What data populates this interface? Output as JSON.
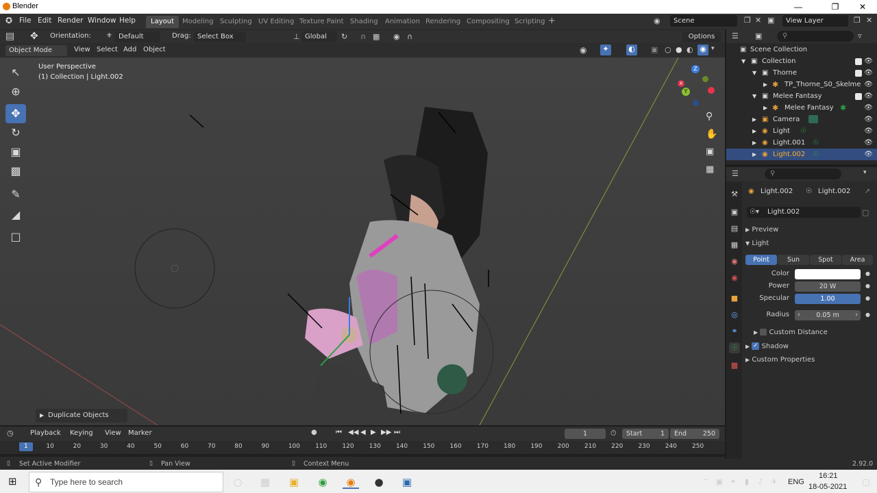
{
  "window": {
    "title": "Blender"
  },
  "menus": [
    "File",
    "Edit",
    "Render",
    "Window",
    "Help"
  ],
  "workspaces": [
    "Layout",
    "Modeling",
    "Sculpting",
    "UV Editing",
    "Texture Paint",
    "Shading",
    "Animation",
    "Rendering",
    "Compositing",
    "Scripting"
  ],
  "active_workspace": "Layout",
  "scene": "Scene",
  "view_layer": "View Layer",
  "header": {
    "orientation_label": "Orientation:",
    "orientation_value": "Default",
    "drag_label": "Drag:",
    "drag_value": "Select Box",
    "transform_orientation": "Global",
    "options": "Options"
  },
  "viewport": {
    "mode": "Object Mode",
    "menu": [
      "View",
      "Select",
      "Add",
      "Object"
    ],
    "overlay_title": "User Perspective",
    "overlay_sub": "(1) Collection | Light.002",
    "operator_panel": "Duplicate Objects",
    "gizmo_axes": [
      "Z",
      "X",
      "Y"
    ]
  },
  "outliner": {
    "items": [
      {
        "label": "Scene Collection",
        "level": 0
      },
      {
        "label": "Collection",
        "level": 1
      },
      {
        "label": "Thorne",
        "level": 2
      },
      {
        "label": "TP_Thorne_S0_Skelme",
        "level": 3
      },
      {
        "label": "Melee Fantasy",
        "level": 2
      },
      {
        "label": "Melee Fantasy",
        "level": 3
      },
      {
        "label": "Camera",
        "level": 2
      },
      {
        "label": "Light",
        "level": 2
      },
      {
        "label": "Light.001",
        "level": 2
      },
      {
        "label": "Light.002",
        "level": 2
      }
    ],
    "selected": "Light.002"
  },
  "properties": {
    "object_name": "Light.002",
    "data_name": "Light.002",
    "datablock": "Light.002",
    "sections": {
      "preview": "Preview",
      "light": "Light",
      "custom_distance": "Custom Distance",
      "shadow": "Shadow",
      "custom_properties": "Custom Properties"
    },
    "light_types": [
      "Point",
      "Sun",
      "Spot",
      "Area"
    ],
    "active_type": "Point",
    "color_label": "Color",
    "power_label": "Power",
    "power_value": "20 W",
    "specular_label": "Specular",
    "specular_value": "1.00",
    "specular_fraction": 1.0,
    "radius_label": "Radius",
    "radius_value": "0.05 m",
    "light_color": "#ffffff"
  },
  "timeline": {
    "menu": [
      "Playback",
      "Keying",
      "View",
      "Marker"
    ],
    "current_frame": "1",
    "start_label": "Start",
    "start": "1",
    "end_label": "End",
    "end": "250",
    "ticks": [
      "1",
      "10",
      "20",
      "30",
      "40",
      "50",
      "60",
      "70",
      "80",
      "90",
      "100",
      "110",
      "120",
      "130",
      "140",
      "150",
      "160",
      "170",
      "180",
      "190",
      "200",
      "210",
      "220",
      "230",
      "240",
      "250"
    ]
  },
  "status": {
    "left": "Set Active Modifier",
    "middle": "Pan View",
    "right": "Context Menu",
    "version": "2.92.0"
  },
  "taskbar": {
    "search_placeholder": "Type here to search",
    "lang": "ENG",
    "time": "16:21",
    "date": "18-05-2021"
  },
  "colors": {
    "accent": "#4772b3",
    "selected_row": "#334d80",
    "light_icon": "#e8a13c"
  }
}
